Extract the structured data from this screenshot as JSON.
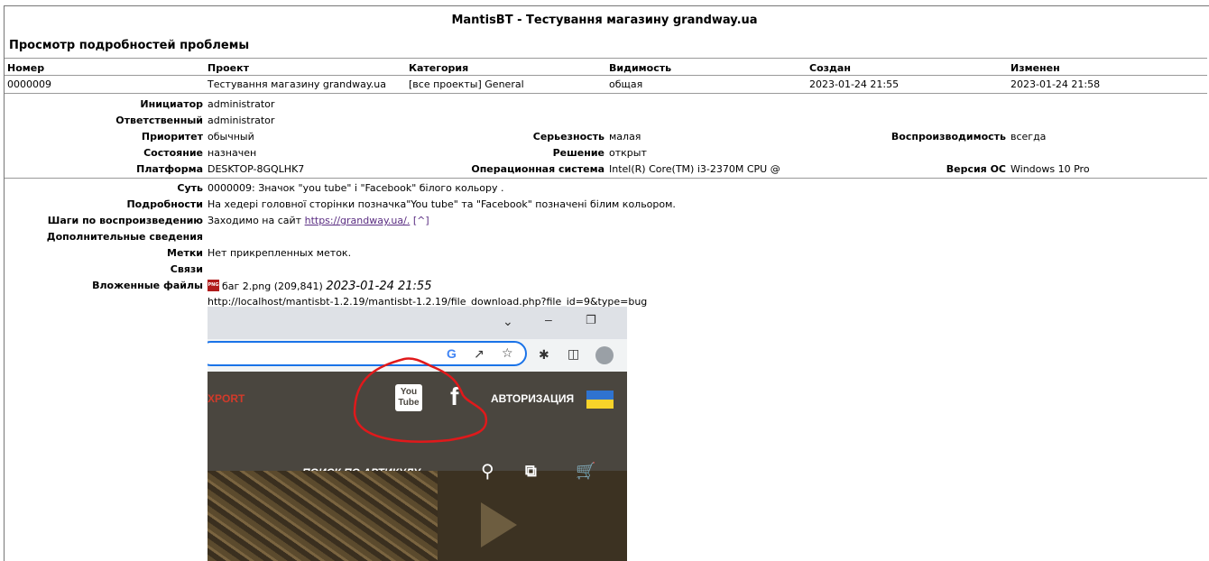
{
  "app_title": "MantisBT - Тестування магазину grandway.ua",
  "section_title": "Просмотр подробностей проблемы",
  "summary_headers": [
    "Номер",
    "Проект",
    "Категория",
    "Видимость",
    "Создан",
    "Изменен"
  ],
  "summary_values": [
    "0000009",
    "Тестування магазину grandway.ua",
    "[все проекты] General",
    "общая",
    "2023-01-24 21:55",
    "2023-01-24 21:58"
  ],
  "details": {
    "reporter_label": "Инициатор",
    "reporter": "administrator",
    "handler_label": "Ответственный",
    "handler": "administrator",
    "priority_label": "Приоритет",
    "priority": "обычный",
    "severity_label": "Серьезность",
    "severity": "малая",
    "reproducibility_label": "Воспроизводимость",
    "reproducibility": "всегда",
    "status_label": "Состояние",
    "status": "назначен",
    "resolution_label": "Решение",
    "resolution": "открыт",
    "platform_label": "Платформа",
    "platform": "DESKTOP-8GQLHK7",
    "os_label": "Операционная система",
    "os": "Intel(R) Core(TM) i3-2370M CPU @",
    "os_version_label": "Версия ОС",
    "os_version": "Windows 10 Pro"
  },
  "description": {
    "summary_label": "Суть",
    "summary": "0000009: Значок \"you tube\" і \"Facebook\" білого кольору .",
    "description_label": "Подробности",
    "description": "На хедері головної сторінки позначка\"You tube\" та \"Facebook\" позначені білим кольором.",
    "steps_label": "Шаги по воспроизведению",
    "steps_text": "Заходимо на сайт ",
    "steps_link": "https://grandway.ua/.",
    "steps_suffix": " [^]",
    "additional_label": "Дополнительные сведения",
    "tags_label": "Метки",
    "tags": "Нет прикрепленных меток.",
    "relations_label": "Связи",
    "attachments_label": "Вложенные файлы"
  },
  "attachment": {
    "icon": "png-file-icon",
    "filename": "баг 2.png (209,841)",
    "date": "2023-01-24 21:55",
    "url": "http://localhost/mantisbt-1.2.19/mantisbt-1.2.19/file_download.php?file_id=9&type=bug"
  },
  "preview": {
    "export_text": "XPORT",
    "auth_text": "АВТОРИЗАЦИЯ",
    "search_text": "ПОИСК ПО АРТИКУЛУ",
    "youtube_top": "You",
    "youtube_bottom": "Tube",
    "facebook_letter": "f",
    "colors": {
      "site_bg": "#4a463f",
      "export": "#d23a2a",
      "circle": "#e0191b"
    }
  }
}
